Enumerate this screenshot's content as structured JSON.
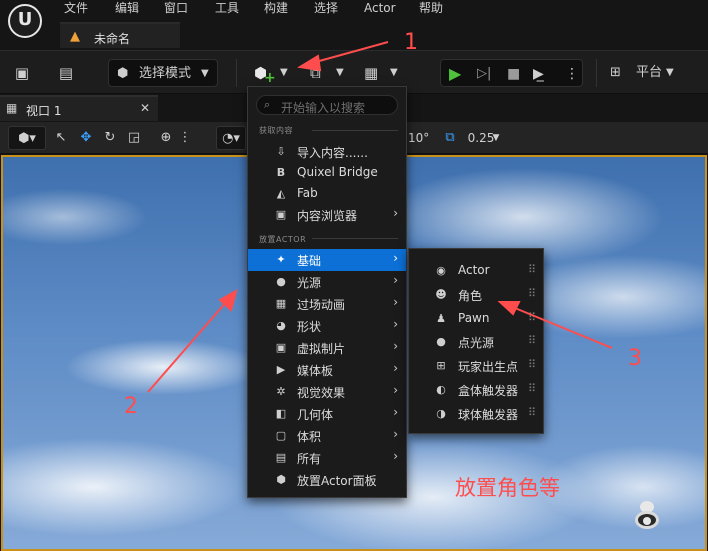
{
  "menubar": {
    "items": [
      "文件",
      "编辑",
      "窗口",
      "工具",
      "构建",
      "选择",
      "Actor",
      "帮助"
    ]
  },
  "document_tab": {
    "title": "未命名"
  },
  "toolbar": {
    "select_mode": "选择模式",
    "platform": "平台"
  },
  "viewport_tab": {
    "title": "视口 1"
  },
  "viewport_toolbar": {
    "angle": "10°",
    "scale": "0.25"
  },
  "main_menu": {
    "search_placeholder": "开始输入以搜索",
    "section_get_content": "获取内容",
    "get_content_items": [
      {
        "label": "导入内容......",
        "icon": "import-icon"
      },
      {
        "label": "Quixel Bridge",
        "icon": "bridge-icon"
      },
      {
        "label": "Fab",
        "icon": "fab-icon"
      },
      {
        "label": "内容浏览器",
        "icon": "content-browser-icon",
        "has_submenu": true
      }
    ],
    "section_place_actor": "放置ACTOR",
    "place_items": [
      {
        "label": "基础",
        "icon": "basic-icon",
        "active": true
      },
      {
        "label": "光源",
        "icon": "light-icon"
      },
      {
        "label": "过场动画",
        "icon": "cinematic-icon"
      },
      {
        "label": "形状",
        "icon": "shapes-icon"
      },
      {
        "label": "虚拟制片",
        "icon": "virtual-production-icon"
      },
      {
        "label": "媒体板",
        "icon": "media-icon"
      },
      {
        "label": "视觉效果",
        "icon": "vfx-icon"
      },
      {
        "label": "几何体",
        "icon": "geometry-icon"
      },
      {
        "label": "体积",
        "icon": "volume-icon"
      },
      {
        "label": "所有",
        "icon": "all-icon"
      },
      {
        "label": "放置Actor面板",
        "icon": "place-actor-panel-icon",
        "no_submenu": true
      }
    ]
  },
  "sub_menu": {
    "items": [
      {
        "label": "Actor",
        "icon": "actor-icon"
      },
      {
        "label": "角色",
        "icon": "character-icon"
      },
      {
        "label": "Pawn",
        "icon": "pawn-icon"
      },
      {
        "label": "点光源",
        "icon": "point-light-icon"
      },
      {
        "label": "玩家出生点",
        "icon": "player-start-icon"
      },
      {
        "label": "盒体触发器",
        "icon": "box-trigger-icon"
      },
      {
        "label": "球体触发器",
        "icon": "sphere-trigger-icon"
      }
    ]
  },
  "annotations": {
    "num1": "1",
    "num2": "2",
    "num3": "3",
    "caption": "放置角色等",
    "color": "#ff4d4d"
  }
}
